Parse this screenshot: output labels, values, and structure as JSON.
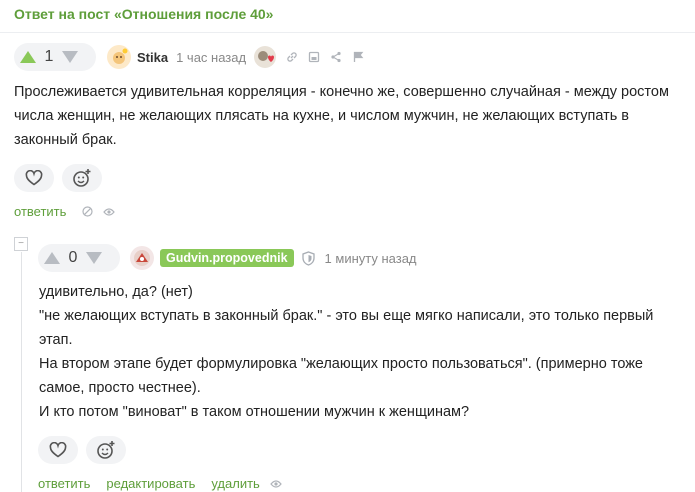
{
  "post": {
    "link_text": "Ответ на пост «Отношения после 40»"
  },
  "comment1": {
    "rating": "1",
    "author": "Stika",
    "time": "1 час назад",
    "text": "Прослеживается удивительная корреляция - конечно же, совершенно случайная - между ростом числа женщин, не желающих плясать на кухне, и числом мужчин, не желающих вступать в законный брак.",
    "reply_label": "ответить"
  },
  "comment2": {
    "rating": "0",
    "author": "Gudvin.propovednik",
    "time": "1 минуту назад",
    "lines": [
      "удивительно, да? (нет)",
      "\"не желающих вступать в законный брак.\" - это вы еще мягко написали, это только первый",
      "этап.",
      "На втором этапе будет формулировка \"желающих просто пользоваться\". (примерно тоже",
      "самое, просто честнее).",
      "И кто потом \"виноват\" в таком отношении мужчин к женщинам?"
    ],
    "reply_label": "ответить",
    "edit_label": "редактировать",
    "delete_label": "удалить"
  },
  "colors": {
    "accent": "#5e9e3a",
    "upvote": "#8ac858",
    "nick_tag": "#8ac858"
  },
  "icons": [
    "arrow-up-icon",
    "arrow-down-icon",
    "heart-icon",
    "emoji-add-icon",
    "link-icon",
    "save-icon",
    "share-icon",
    "flag-icon",
    "hide-icon",
    "eye-icon",
    "shield-icon"
  ]
}
